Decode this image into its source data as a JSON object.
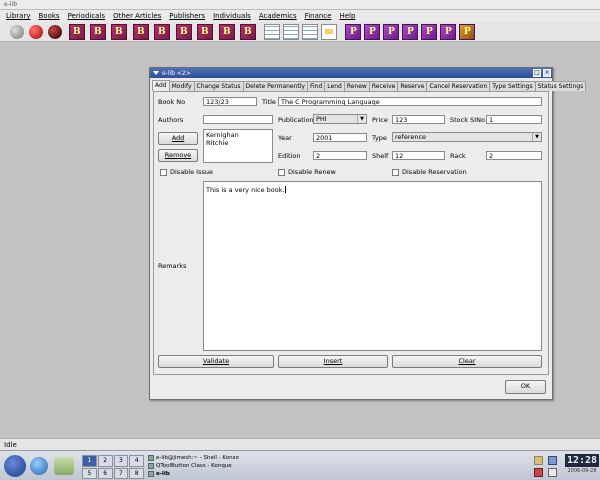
{
  "app": {
    "title": "e-lib"
  },
  "menu": [
    "Library",
    "Books",
    "Periodicals",
    "Other Articles",
    "Publishers",
    "Individuals",
    "Academics",
    "Finance",
    "Help"
  ],
  "colors": {
    "magenta_icon": "#9a2a60",
    "purple_icon": "#8a2aa8",
    "titlebar": "#3a5aa4",
    "desktop": "#c3c3c3"
  },
  "toolbar": {
    "icons": [
      "gray-circle-icon",
      "red-globe-icon",
      "dark-circle-icon",
      "book-icon",
      "book-icon",
      "book-icon",
      "book-icon",
      "book-icon",
      "book-icon",
      "book-icon",
      "book-icon",
      "book-icon",
      "table-icon",
      "table-icon",
      "table-icon",
      "document-icon",
      "periodical-icon",
      "periodical-icon",
      "periodical-icon",
      "periodical-icon",
      "periodical-icon",
      "periodical-icon"
    ]
  },
  "window": {
    "title": "e-lib <2>",
    "close": "×",
    "minimize": "_",
    "maximize": "□"
  },
  "tabs": [
    "Add",
    "Modify",
    "Change Status",
    "Delete Permanently",
    "Find",
    "Lend",
    "Renew",
    "Receive",
    "Reserve",
    "Cancel Reservation",
    "Type Settings",
    "Status Settings"
  ],
  "form": {
    "book_no": {
      "label": "Book No",
      "value": "123/23"
    },
    "title": {
      "label": "Title",
      "value": "The C Programming Language"
    },
    "authors": {
      "label": "Authors",
      "value": "",
      "list": [
        "Kernighan",
        "Ritchie"
      ]
    },
    "add_button": "Add",
    "remove_button": "Remove",
    "publication": {
      "label": "Publication",
      "value": "PHI"
    },
    "price": {
      "label": "Price",
      "value": "123"
    },
    "stock_sino": {
      "label": "Stock SINo",
      "value": "1"
    },
    "year": {
      "label": "Year",
      "value": "2001"
    },
    "type": {
      "label": "Type",
      "value": "reference"
    },
    "edition": {
      "label": "Edition",
      "value": "2"
    },
    "shelf": {
      "label": "Shelf",
      "value": "12"
    },
    "rack": {
      "label": "Rack",
      "value": "2"
    },
    "disable_issue": "Disable Issue",
    "disable_renew": "Disable Renew",
    "disable_reservation": "Disable Reservation",
    "remarks": {
      "label": "Remarks",
      "value": "This is a very nice book."
    },
    "validate_button": "Validate",
    "insert_button": "Insert",
    "clear_button": "Clear",
    "ok_button": "OK",
    "dropdown_arrow": "▼"
  },
  "status": {
    "text": "Idle"
  },
  "taskbar": {
    "pager": [
      "1",
      "2",
      "3",
      "4",
      "5",
      "6",
      "7",
      "8"
    ],
    "tasks": [
      "e-lib@jimesh:~ - Shell - Konso",
      "QToolButton Class - Konque",
      "e-lib"
    ],
    "clock_time": "12:28",
    "clock_date": "2006-09-28"
  }
}
